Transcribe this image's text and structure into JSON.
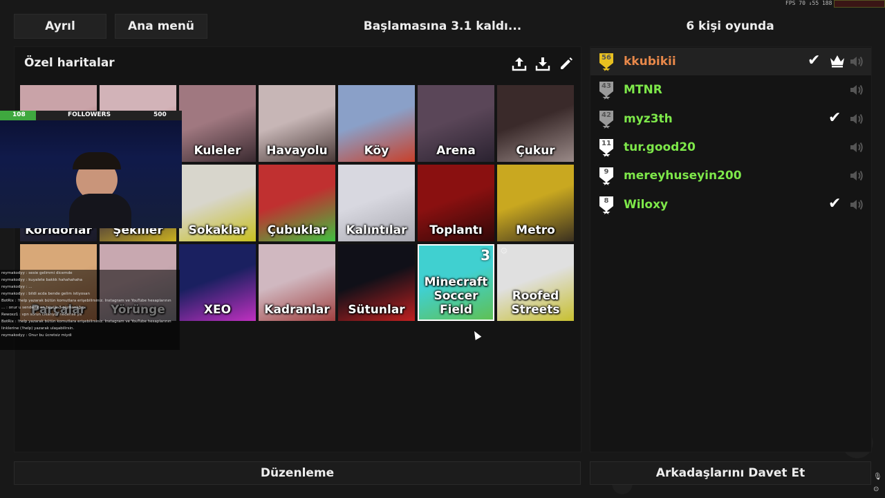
{
  "top": {
    "leave": "Ayrıl",
    "main_menu": "Ana menü",
    "countdown": "Başlamasına 3.1 kaldı...",
    "players_count": "6 kişi oyunda",
    "fps": "FPS 70  ↓55 188"
  },
  "maps_panel": {
    "title": "Özel haritalar",
    "tools": [
      "upload-icon",
      "download-icon",
      "edit-icon"
    ],
    "maps": [
      {
        "label": "",
        "c1": "#c9a3a8",
        "c2": "#7a3a3a"
      },
      {
        "label": "",
        "c1": "#d2b3b8",
        "c2": "#a34747"
      },
      {
        "label": "Kuleler",
        "c1": "#a07880",
        "c2": "#3a2a30"
      },
      {
        "label": "Havayolu",
        "c1": "#c7b6b6",
        "c2": "#4a3a38"
      },
      {
        "label": "Köy",
        "c1": "#8aa0c8",
        "c2": "#c8402a"
      },
      {
        "label": "Arena",
        "c1": "#5a4658",
        "c2": "#2a2230"
      },
      {
        "label": "Çukur",
        "c1": "#3a2a2a",
        "c2": "#9a8a88"
      },
      {
        "label": "Koridorlar",
        "c1": "#2a2a40",
        "c2": "#1a1a28"
      },
      {
        "label": "Şekiller",
        "c1": "#3a2a40",
        "c2": "#c9b020"
      },
      {
        "label": "Sokaklar",
        "c1": "#d8d6cc",
        "c2": "#c8c020"
      },
      {
        "label": "Çubuklar",
        "c1": "#c03030",
        "c2": "#40c040"
      },
      {
        "label": "Kalıntılar",
        "c1": "#d8d8e0",
        "c2": "#a8a8b0"
      },
      {
        "label": "Toplantı",
        "c1": "#8a1010",
        "c2": "#300808"
      },
      {
        "label": "Metro",
        "c1": "#c9a820",
        "c2": "#3a3020"
      },
      {
        "label": "Parçalar",
        "c1": "#d8a878",
        "c2": "#b07048"
      },
      {
        "label": "Yörünge",
        "c1": "#c8a8b0",
        "c2": "#8a8890"
      },
      {
        "label": "XEO",
        "c1": "#1a2060",
        "c2": "#c030c0"
      },
      {
        "label": "Kadranlar",
        "c1": "#d0b8c0",
        "c2": "#a04040"
      },
      {
        "label": "Sütunlar",
        "c1": "#101018",
        "c2": "#c02020"
      },
      {
        "label": "Minecraft Soccer Field",
        "c1": "#40d0d0",
        "c2": "#60c050",
        "votes": "3",
        "selected": true
      },
      {
        "label": "Roofed Streets",
        "c1": "#e0e0e0",
        "c2": "#c8c030",
        "gear": true
      }
    ]
  },
  "players_panel": {
    "players": [
      {
        "name": "kkubikii",
        "level": "56",
        "color": "#e8884a",
        "badge": "#e8c020",
        "check": true,
        "crown": true
      },
      {
        "name": "MTNR",
        "level": "43",
        "color": "#7ee84a",
        "badge": "#9a9a9a",
        "check": false,
        "crown": false
      },
      {
        "name": "myz3th",
        "level": "42",
        "color": "#7ee84a",
        "badge": "#9a9a9a",
        "check": true,
        "crown": false
      },
      {
        "name": "tur.good20",
        "level": "11",
        "color": "#7ee84a",
        "badge": "#ffffff",
        "check": false,
        "crown": false
      },
      {
        "name": "mereyhuseyin200",
        "level": "9",
        "color": "#7ee84a",
        "badge": "#ffffff",
        "check": false,
        "crown": false
      },
      {
        "name": "Wiloxy",
        "level": "8",
        "color": "#7ee84a",
        "badge": "#ffffff",
        "check": true,
        "crown": false
      }
    ]
  },
  "bottom": {
    "edit": "Düzenleme",
    "invite": "Arkadaşlarını Davet Et"
  },
  "overlay": {
    "follower_count": "108",
    "followers_label": "FOLLOWERS",
    "follower_goal": "500",
    "chat": [
      "reymakodyy : sesie gelimmi dicemde",
      "reymakodyy : kuyalete bakkk hahahahaha",
      "reymakodyy : ...",
      "reymakodyy : bildi acda bende gelim istiyosan",
      "BotRix : !help yazarak bütün komutlara erişebilirsiniz. Instagram ve YouTube hesaplarının",
      "... : onur u sendedir en büyük 3 pişmanlığın",
      "Rewoxz1 : vpn sorun cıkarıyor nedense ya",
      "BotRix : !help yazarak bütün komutlara erişebilirsiniz. Instagram ve YouTube hesaplarının",
      "linklerine (!help) yazarak ulaşabilirsin.",
      "reymakodyy : Onur bu ücretsiz miydi"
    ]
  }
}
